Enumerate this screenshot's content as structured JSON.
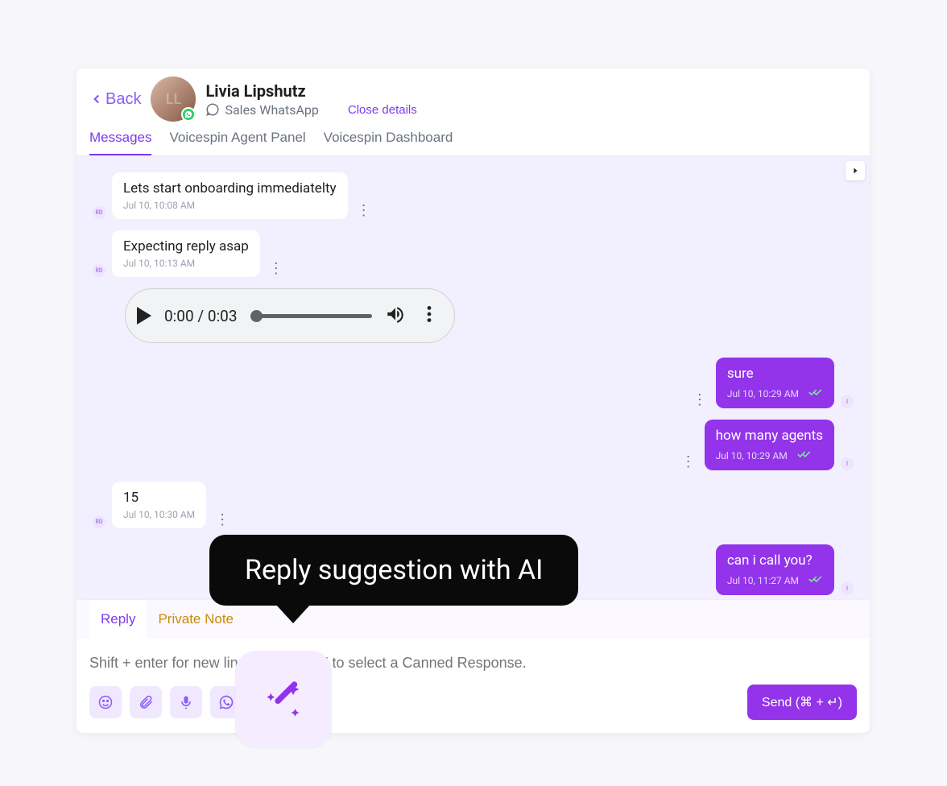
{
  "header": {
    "back_label": "Back",
    "contact_name": "Livia Lipshutz",
    "channel_label": "Sales WhatsApp",
    "close_details_label": "Close details",
    "avatar_initials": "LL"
  },
  "tabs": [
    {
      "label": "Messages",
      "active": true
    },
    {
      "label": "Voicespin Agent Panel",
      "active": false
    },
    {
      "label": "Voicespin Dashboard",
      "active": false
    }
  ],
  "messages": [
    {
      "dir": "in",
      "text": "Lets start onboarding immediatelty",
      "timestamp": "Jul 10, 10:08 AM",
      "avatar": "RD"
    },
    {
      "dir": "in",
      "text": "Expecting reply asap",
      "timestamp": "Jul 10, 10:13 AM",
      "avatar": "RD"
    },
    {
      "dir": "audio",
      "current": "0:00",
      "duration": "0:03"
    },
    {
      "dir": "out",
      "text": "sure",
      "timestamp": "Jul 10, 10:29 AM",
      "avatar": "I"
    },
    {
      "dir": "out",
      "text": "how many agents",
      "timestamp": "Jul 10, 10:29 AM",
      "avatar": "I"
    },
    {
      "dir": "in",
      "text": "15",
      "timestamp": "Jul 10, 10:30 AM",
      "avatar": "RD"
    },
    {
      "dir": "out",
      "text": "can i call you?",
      "timestamp": "Jul 10, 11:27 AM",
      "avatar": "I"
    }
  ],
  "audio": {
    "time_display": "0:00 / 0:03"
  },
  "composer": {
    "tabs": {
      "reply": "Reply",
      "private_note": "Private Note"
    },
    "placeholder": "Shift + enter for new line. Start with '/' to select a Canned Response.",
    "send_label": "Send (⌘ + ↵)"
  },
  "tooltip": {
    "text": "Reply suggestion with AI"
  }
}
